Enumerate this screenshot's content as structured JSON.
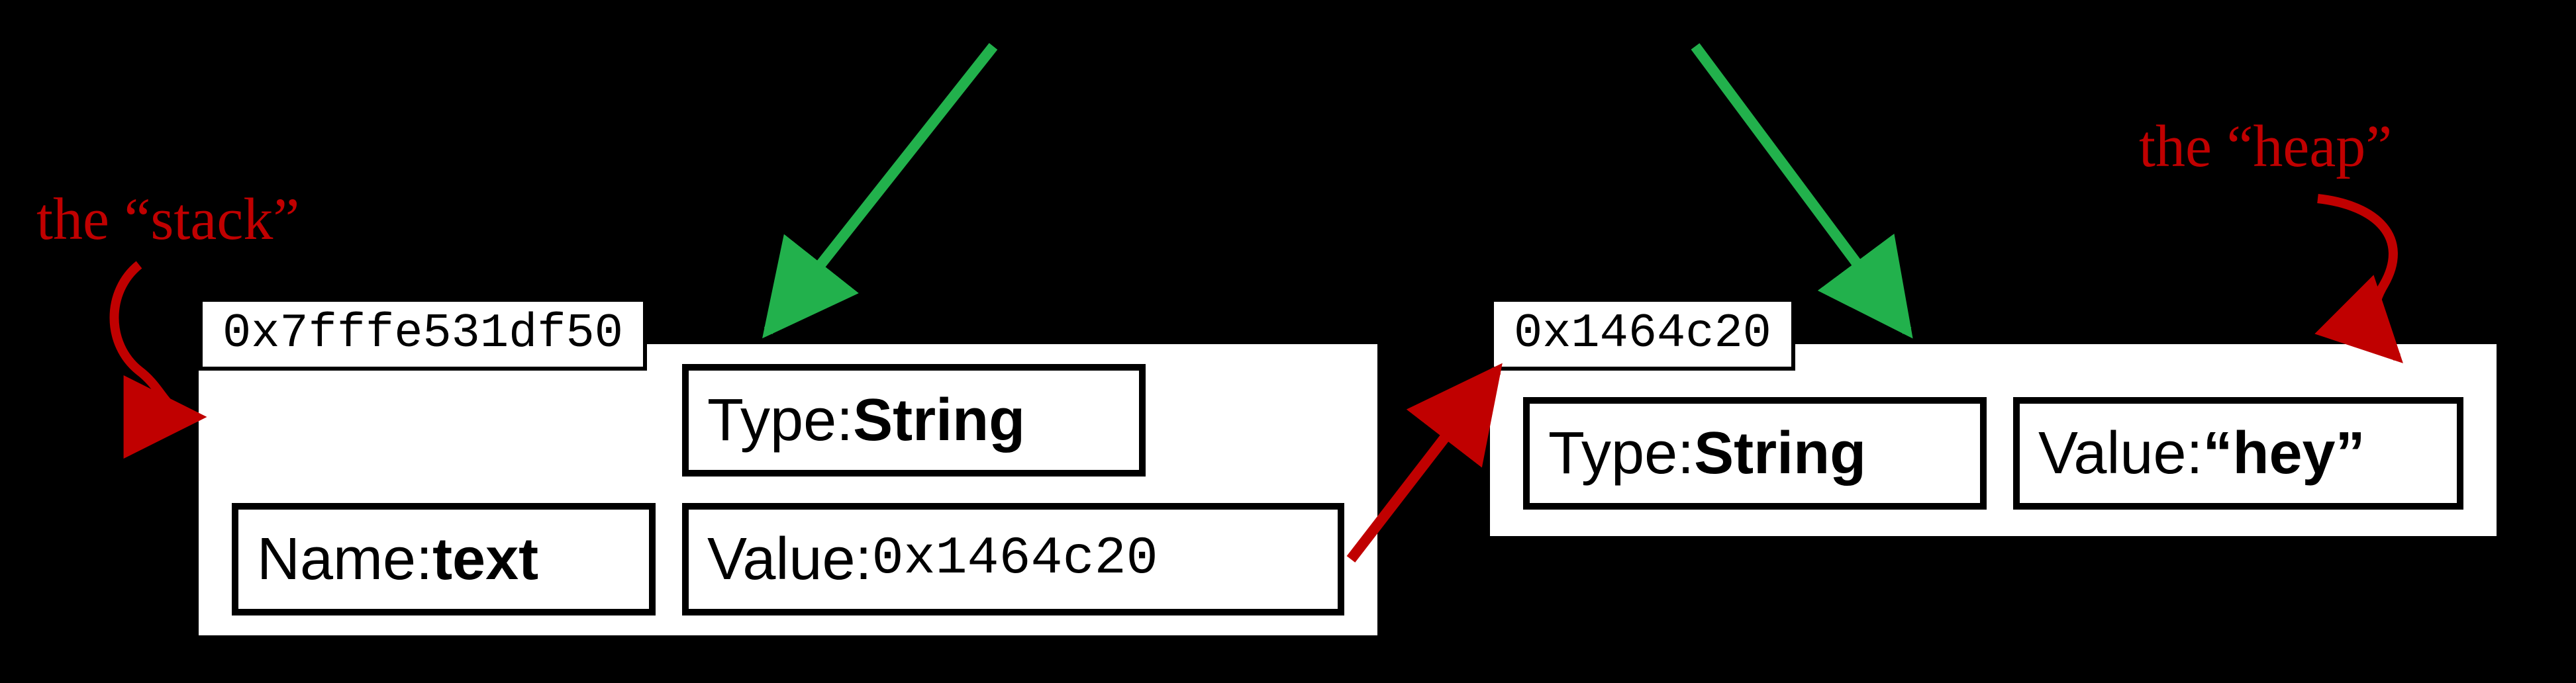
{
  "annotations": {
    "stack_label": "the “stack”",
    "heap_label": "the “heap”"
  },
  "stack": {
    "address": "0x7fffe531df50",
    "type_label": "Type: ",
    "type_value": "String",
    "name_label": "Name: ",
    "name_value": "text",
    "value_label": "Value: ",
    "value_value": "0x1464c20"
  },
  "heap": {
    "address": "0x1464c20",
    "type_label": "Type: ",
    "type_value": "String",
    "value_label": "Value: ",
    "value_value": "“hey”"
  },
  "colors": {
    "green_arrow": "#22b14c",
    "red_arrow": "#c00000"
  }
}
